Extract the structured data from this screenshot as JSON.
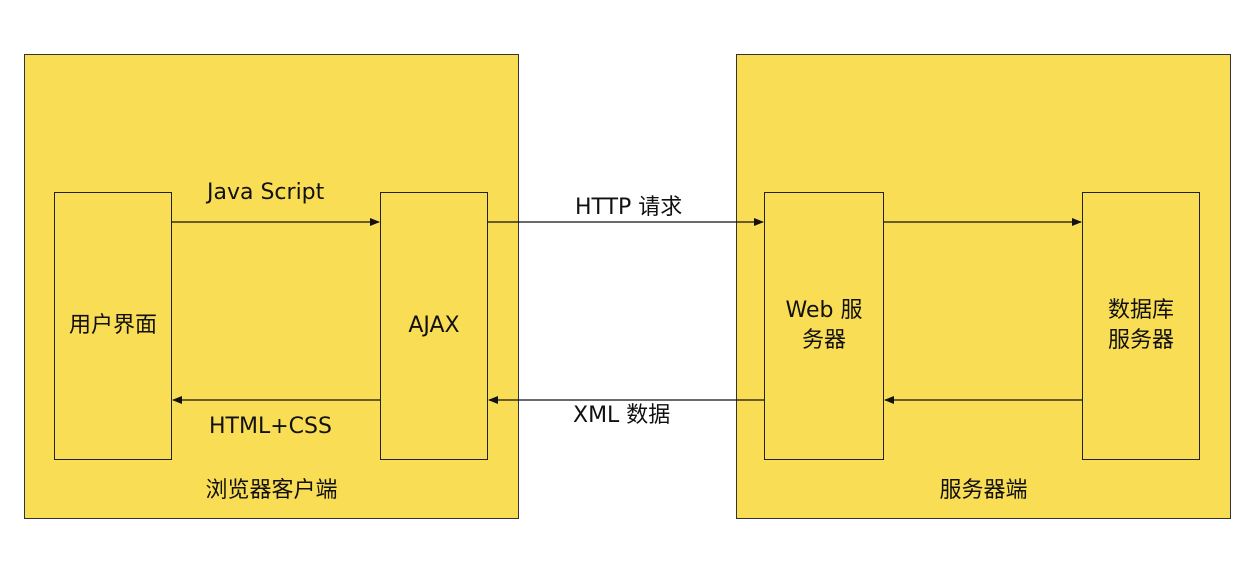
{
  "groups": {
    "client": {
      "label": "浏览器客户端"
    },
    "server": {
      "label": "服务器端"
    }
  },
  "nodes": {
    "ui": {
      "label": "用户界面"
    },
    "ajax": {
      "label": "AJAX"
    },
    "web": {
      "line1": "Web 服",
      "line2": "务器"
    },
    "db": {
      "line1": "数据库",
      "line2": "服务器"
    }
  },
  "edges": {
    "js": {
      "label": "Java Script"
    },
    "htmlcss": {
      "label": "HTML+CSS"
    },
    "http": {
      "label": "HTTP 请求"
    },
    "xml": {
      "label": "XML 数据"
    }
  },
  "colors": {
    "fill": "#f9dd55",
    "stroke": "#222222"
  }
}
